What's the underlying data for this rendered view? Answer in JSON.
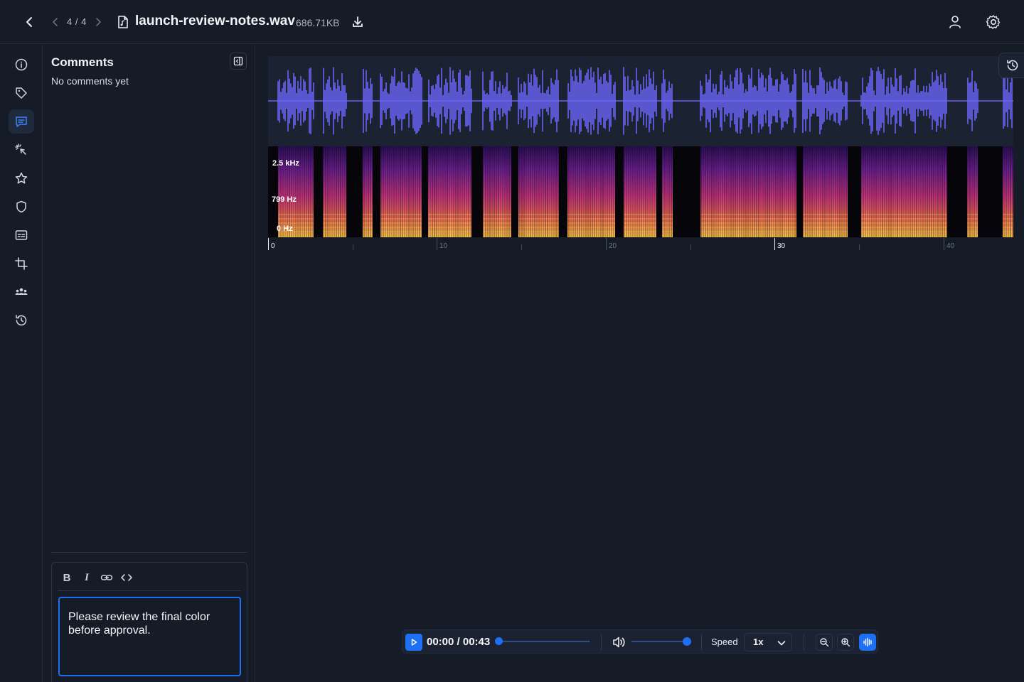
{
  "topbar": {
    "counter": "4 / 4",
    "filename": "launch-review-notes.wav",
    "filesize": "686.71KB",
    "icons": [
      "back-arrow-icon",
      "chevron-left-icon",
      "chevron-right-icon",
      "audio-file-icon",
      "download-icon",
      "user-icon",
      "gear-icon"
    ]
  },
  "sidebar": {
    "items": [
      {
        "icon": "info-icon"
      },
      {
        "icon": "tag-icon"
      },
      {
        "icon": "comment-icon",
        "active": true
      },
      {
        "icon": "magic-select-icon"
      },
      {
        "icon": "star-icon"
      },
      {
        "icon": "shield-icon"
      },
      {
        "icon": "caption-icon"
      },
      {
        "icon": "crop-icon"
      },
      {
        "icon": "users-icon"
      },
      {
        "icon": "history-icon"
      }
    ]
  },
  "comments": {
    "title": "Comments",
    "empty_text": "No comments yet",
    "editor": {
      "toolbar": {
        "bold": "B",
        "italic": "I"
      },
      "value": "Please review the final color before approval."
    }
  },
  "viewer": {
    "waveform_color": "#6b63f5",
    "spectrogram_labels": [
      "2.5 kHz",
      "799 Hz",
      "0 Hz"
    ],
    "timeline_labels": [
      "0",
      "10",
      "20",
      "30",
      "40"
    ]
  },
  "player": {
    "time": "00:00 / 00:43",
    "progress": 0,
    "volume": 1,
    "speed_label": "Speed",
    "speed_value": "1x",
    "accent": "#1f6ff5"
  }
}
